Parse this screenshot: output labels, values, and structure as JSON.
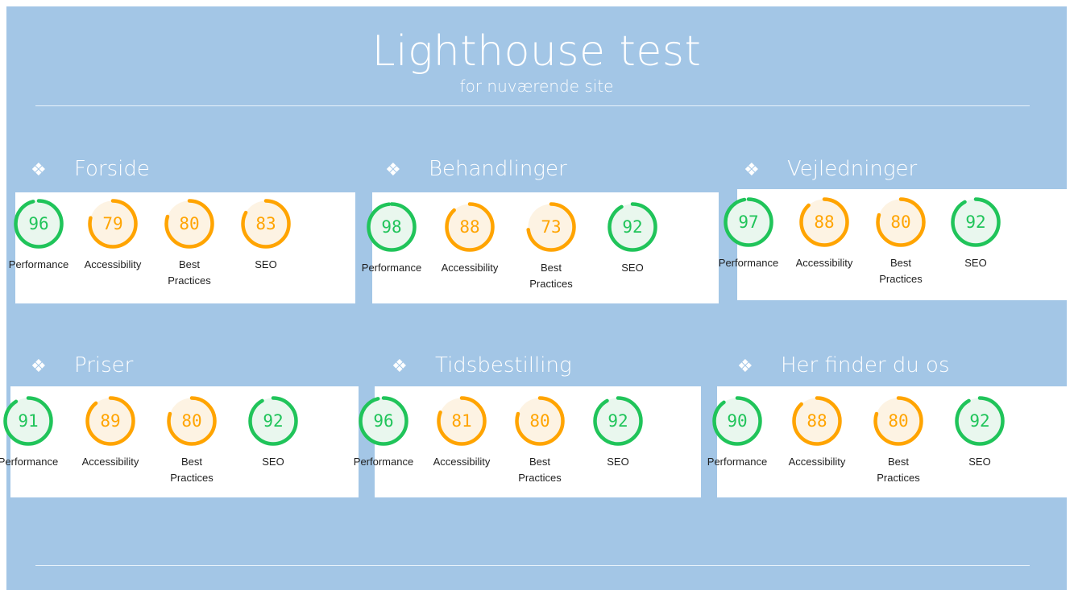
{
  "title": "Lighthouse test",
  "subtitle": "for nuværende site",
  "bullet_glyph": "❖",
  "colors": {
    "good": "#20c45a",
    "average": "#ffa400",
    "good_fill": "#e9f7ee",
    "average_fill": "#fdf3e3"
  },
  "metric_labels": [
    "Performance",
    "Accessibility",
    "Best Practices",
    "SEO"
  ],
  "sections": [
    {
      "name": "Forside",
      "scores": [
        96,
        79,
        80,
        83
      ]
    },
    {
      "name": "Behandlinger",
      "scores": [
        98,
        88,
        73,
        92
      ]
    },
    {
      "name": "Vejledninger",
      "scores": [
        97,
        88,
        80,
        92
      ]
    },
    {
      "name": "Priser",
      "scores": [
        91,
        89,
        80,
        92
      ]
    },
    {
      "name": "Tidsbestilling",
      "scores": [
        96,
        81,
        80,
        92
      ]
    },
    {
      "name": "Her finder du os",
      "scores": [
        90,
        88,
        80,
        92
      ]
    }
  ]
}
